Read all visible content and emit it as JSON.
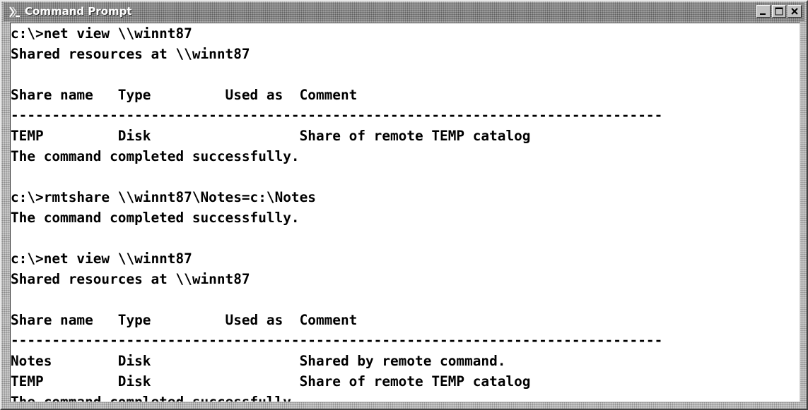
{
  "window": {
    "title": "Command Prompt",
    "icon": "console-icon",
    "controls": [
      "minimize-icon",
      "maximize-icon",
      "close-icon"
    ]
  },
  "console": {
    "lines": [
      "c:\\>net view \\\\winnt87",
      "Shared resources at \\\\winnt87",
      "",
      "Share name   Type         Used as  Comment",
      "-------------------------------------------------------------------------------",
      "TEMP         Disk                  Share of remote TEMP catalog",
      "The command completed successfully.",
      "",
      "c:\\>rmtshare \\\\winnt87\\Notes=c:\\Notes",
      "The command completed successfully.",
      "",
      "c:\\>net view \\\\winnt87",
      "Shared resources at \\\\winnt87",
      "",
      "Share name   Type         Used as  Comment",
      "-------------------------------------------------------------------------------",
      "Notes        Disk                  Shared by remote command.",
      "TEMP         Disk                  Share of remote TEMP catalog",
      "The command completed successfully."
    ]
  }
}
